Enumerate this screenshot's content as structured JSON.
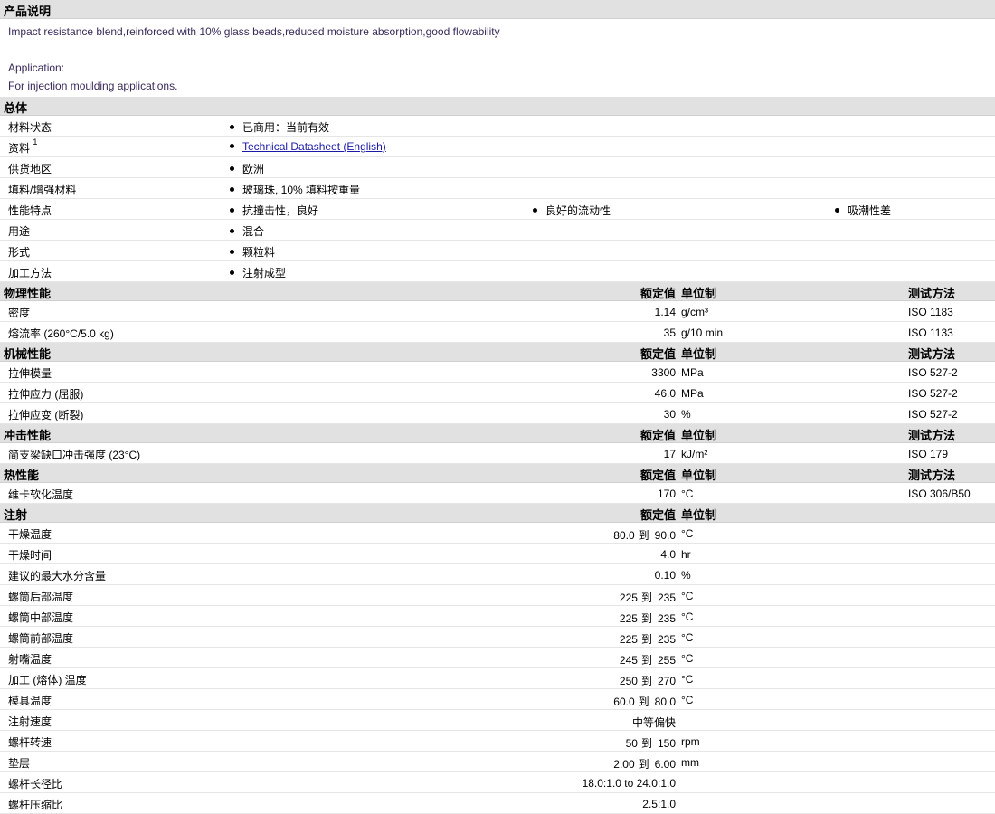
{
  "desc": {
    "title": "产品说明",
    "line1": "Impact resistance blend,reinforced with 10% glass beads,reduced moisture absorption,good flowability",
    "app_label": "Application:",
    "app_text": "For injection moulding applications."
  },
  "general": {
    "title": "总体",
    "rows": [
      {
        "label": "材料状态",
        "values": [
          "已商用：当前有效"
        ]
      },
      {
        "label": "资料",
        "sup": "1",
        "link": "Technical Datasheet (English)"
      },
      {
        "label": "供货地区",
        "values": [
          "欧洲"
        ]
      },
      {
        "label": "填料/增强材料",
        "values": [
          "玻璃珠, 10% 填料按重量"
        ]
      },
      {
        "label": "性能特点",
        "values": [
          "抗撞击性，良好",
          "良好的流动性",
          "吸潮性差"
        ]
      },
      {
        "label": "用途",
        "values": [
          "混合"
        ]
      },
      {
        "label": "形式",
        "values": [
          "颗粒料"
        ]
      },
      {
        "label": "加工方法",
        "values": [
          "注射成型"
        ]
      }
    ]
  },
  "headers": {
    "nominal": "额定值",
    "unit": "单位制",
    "test": "测试方法"
  },
  "physical": {
    "title": "物理性能",
    "rows": [
      {
        "label": "密度",
        "value": "1.14",
        "unit": "g/cm³",
        "test": "ISO 1183"
      },
      {
        "label": "熔流率 (260°C/5.0 kg)",
        "value": "35",
        "unit": "g/10 min",
        "test": "ISO 1133"
      }
    ]
  },
  "mechanical": {
    "title": "机械性能",
    "rows": [
      {
        "label": "拉伸模量",
        "value": "3300",
        "unit": "MPa",
        "test": "ISO 527-2"
      },
      {
        "label": "拉伸应力 (屈服)",
        "value": "46.0",
        "unit": "MPa",
        "test": "ISO 527-2"
      },
      {
        "label": "拉伸应变 (断裂)",
        "value": "30",
        "unit": "%",
        "test": "ISO 527-2"
      }
    ]
  },
  "impact": {
    "title": "冲击性能",
    "rows": [
      {
        "label": "简支梁缺口冲击强度 (23°C)",
        "value": "17",
        "unit": "kJ/m²",
        "test": "ISO 179"
      }
    ]
  },
  "thermal": {
    "title": "热性能",
    "rows": [
      {
        "label": "维卡软化温度",
        "value": "170",
        "unit": "°C",
        "test": "ISO 306/B50"
      }
    ]
  },
  "injection": {
    "title": "注射",
    "to": "到",
    "rows": [
      {
        "label": "干燥温度",
        "min": "80.0",
        "max": "90.0",
        "unit": "°C"
      },
      {
        "label": "干燥时间",
        "value": "4.0",
        "unit": "hr"
      },
      {
        "label": "建议的最大水分含量",
        "value": "0.10",
        "unit": "%"
      },
      {
        "label": "螺筒后部温度",
        "min": "225",
        "max": "235",
        "unit": "°C"
      },
      {
        "label": "螺筒中部温度",
        "min": "225",
        "max": "235",
        "unit": "°C"
      },
      {
        "label": "螺筒前部温度",
        "min": "225",
        "max": "235",
        "unit": "°C"
      },
      {
        "label": "射嘴温度",
        "min": "245",
        "max": "255",
        "unit": "°C"
      },
      {
        "label": "加工 (熔体) 温度",
        "min": "250",
        "max": "270",
        "unit": "°C"
      },
      {
        "label": "模具温度",
        "min": "60.0",
        "max": "80.0",
        "unit": "°C"
      },
      {
        "label": "注射速度",
        "value": "中等偏快",
        "unit": ""
      },
      {
        "label": "螺杆转速",
        "min": "50",
        "max": "150",
        "unit": "rpm"
      },
      {
        "label": "垫层",
        "min": "2.00",
        "max": "6.00",
        "unit": "mm"
      },
      {
        "label": "螺杆长径比",
        "value": "18.0:1.0 to 24.0:1.0",
        "unit": ""
      },
      {
        "label": "螺杆压缩比",
        "value": "2.5:1.0",
        "unit": ""
      }
    ]
  }
}
